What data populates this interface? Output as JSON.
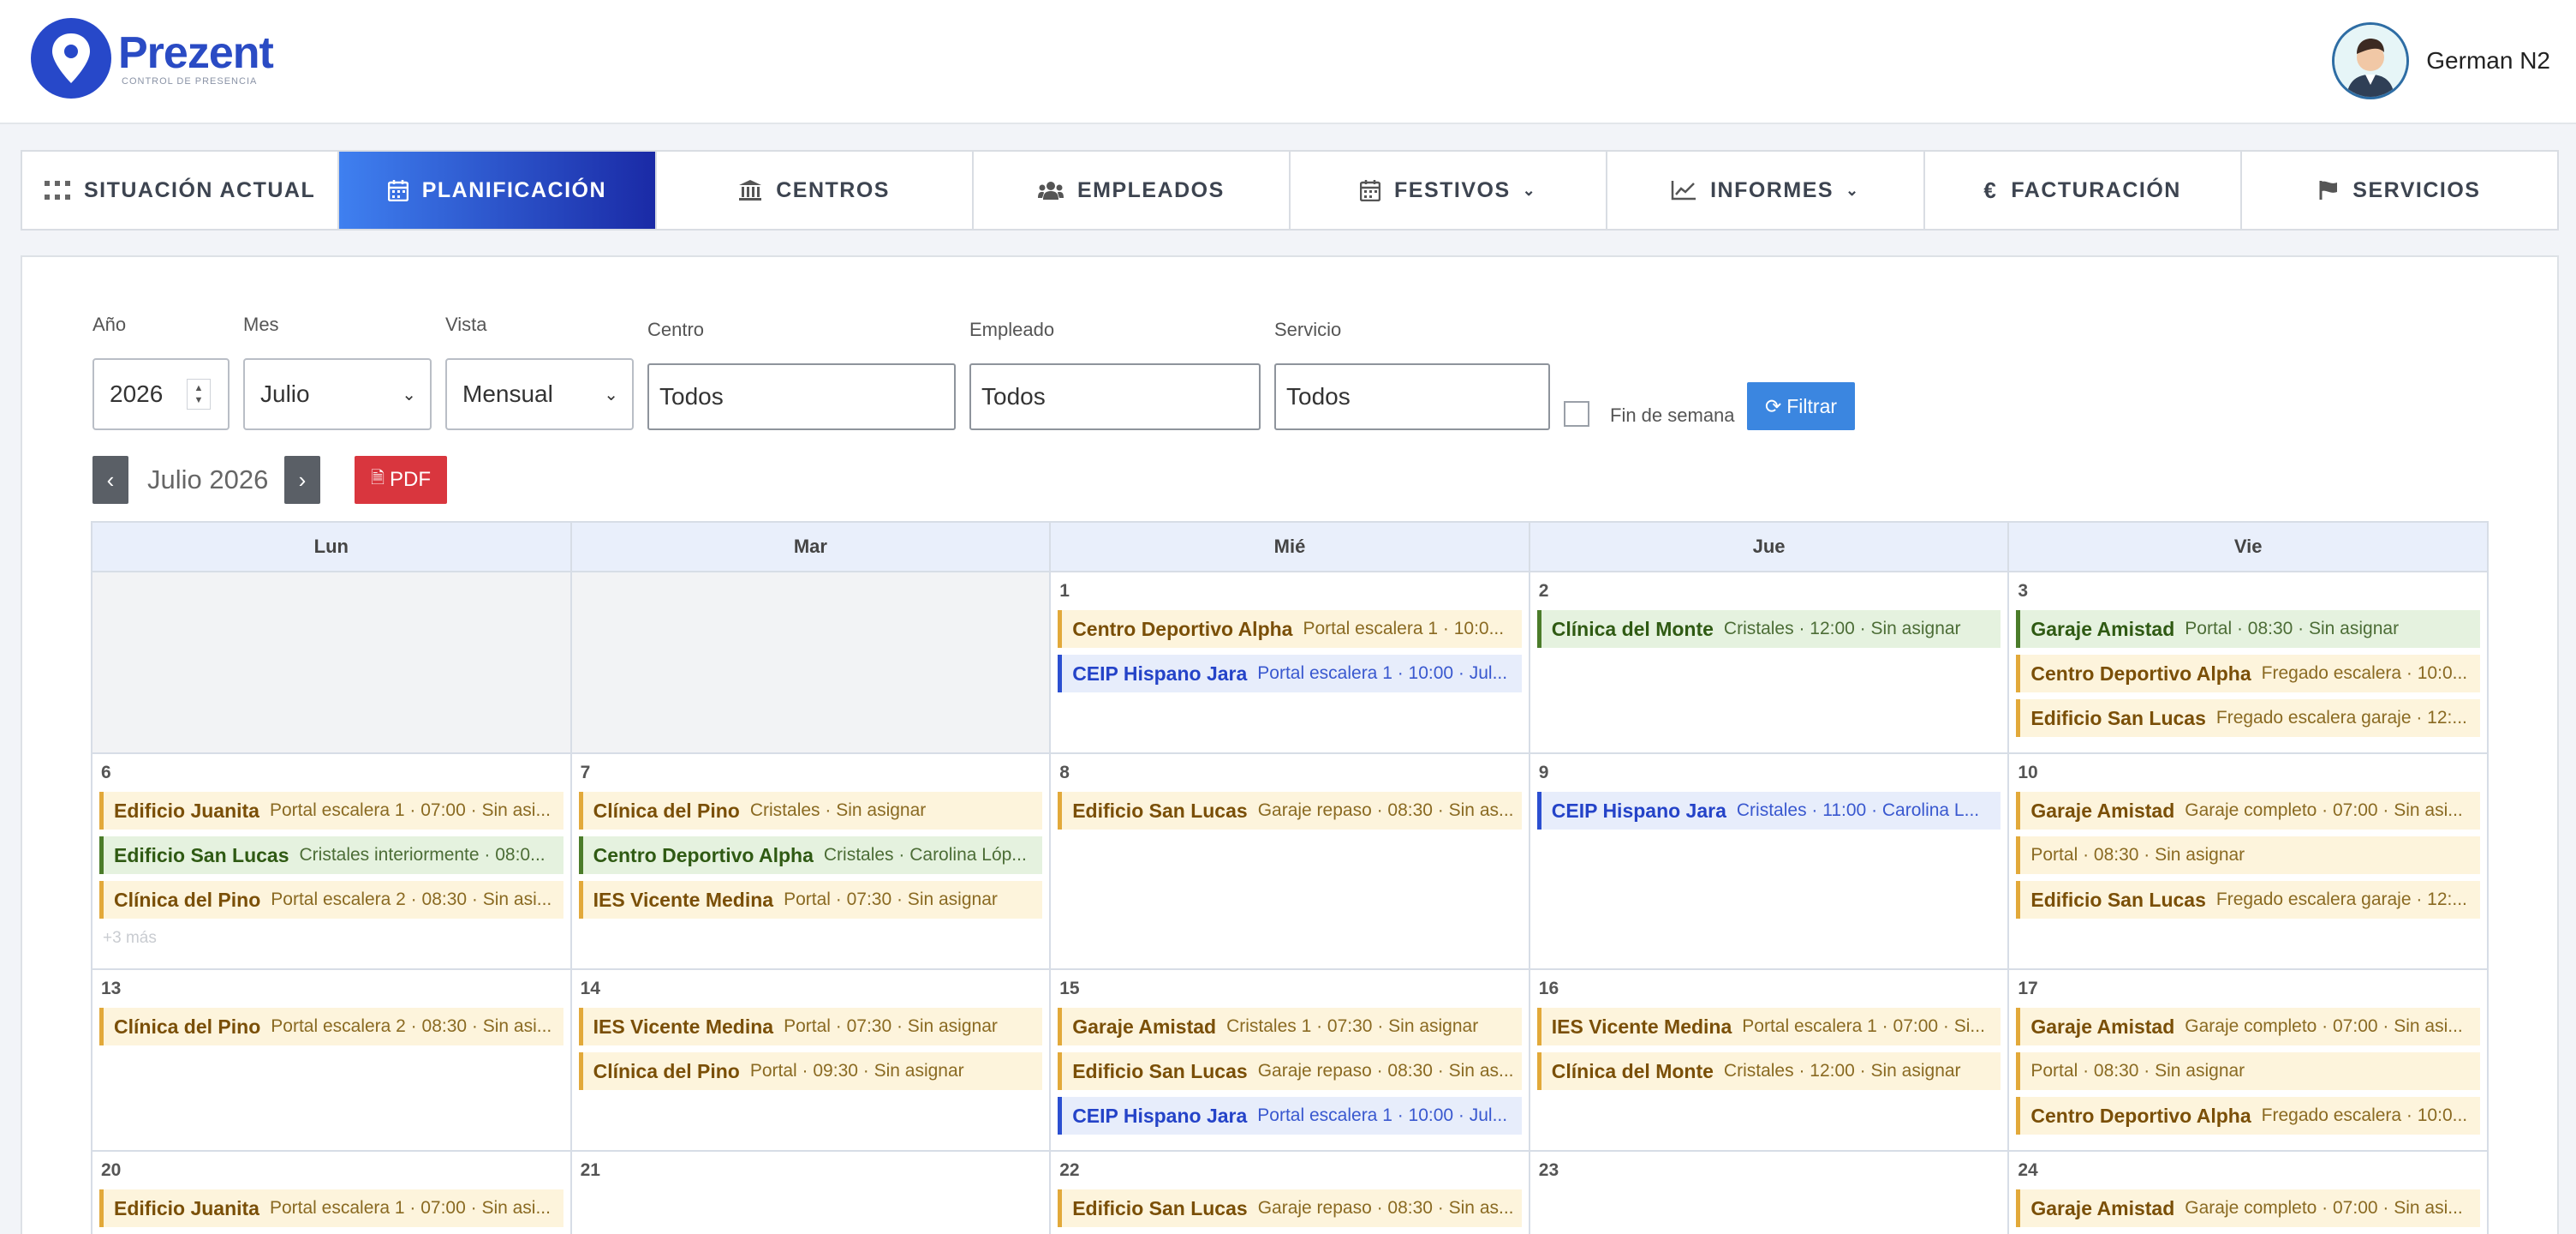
{
  "header": {
    "logo_name": "Prezent",
    "logo_sub": "CONTROL DE PRESENCIA",
    "user_name": "German N2"
  },
  "nav": {
    "items": [
      {
        "label": "SITUACIÓN ACTUAL",
        "icon": "grid-icon"
      },
      {
        "label": "PLANIFICACIÓN",
        "icon": "calendar-icon",
        "active": true
      },
      {
        "label": "CENTROS",
        "icon": "building-icon"
      },
      {
        "label": "EMPLEADOS",
        "icon": "users-icon"
      },
      {
        "label": "FESTIVOS",
        "icon": "calendar-icon",
        "dropdown": true
      },
      {
        "label": "INFORMES",
        "icon": "chart-icon",
        "dropdown": true
      },
      {
        "label": "FACTURACIÓN",
        "icon": "euro-icon"
      },
      {
        "label": "SERVICIOS",
        "icon": "flag-icon"
      }
    ]
  },
  "filters": {
    "year_label": "Año",
    "year_value": "2026",
    "month_label": "Mes",
    "month_value": "Julio",
    "view_label": "Vista",
    "view_value": "Mensual",
    "center_label": "Centro",
    "center_placeholder": "Todos",
    "employee_label": "Empleado",
    "employee_placeholder": "Todos",
    "service_label": "Servicio",
    "service_placeholder": "Todos",
    "weekend_label": "Fin de semana",
    "filter_button": "Filtrar"
  },
  "calendar": {
    "title": "Julio 2026",
    "prev": "‹",
    "next": "›",
    "pdf_button": "PDF",
    "days": [
      "Lun",
      "Mar",
      "Mié",
      "Jue",
      "Vie"
    ],
    "weeks": [
      [
        {
          "n": "",
          "events": []
        },
        {
          "n": "",
          "events": []
        },
        {
          "n": "1",
          "events": [
            {
              "c": "y",
              "name": "Centro Deportivo Alpha",
              "detail": "Portal escalera 1 · 10:0..."
            },
            {
              "c": "b",
              "name": "CEIP Hispano Jara",
              "detail": "Portal escalera 1 · 10:00 · Jul..."
            }
          ]
        },
        {
          "n": "2",
          "events": [
            {
              "c": "g",
              "name": "Clínica del Monte",
              "detail": "Cristales · 12:00 · Sin asignar"
            }
          ]
        },
        {
          "n": "3",
          "events": [
            {
              "c": "g",
              "name": "Garaje Amistad",
              "detail": "Portal · 08:30 · Sin asignar"
            },
            {
              "c": "y",
              "name": "Centro Deportivo Alpha",
              "detail": "Fregado escalera · 10:0..."
            },
            {
              "c": "y",
              "name": "Edificio San Lucas",
              "detail": "Fregado escalera garaje · 12:..."
            }
          ]
        }
      ],
      [
        {
          "n": "6",
          "more": "+3 más",
          "events": [
            {
              "c": "y",
              "name": "Edificio Juanita",
              "detail": "Portal escalera 1 · 07:00 · Sin asi..."
            },
            {
              "c": "g",
              "name": "Edificio San Lucas",
              "detail": "Cristales interiormente · 08:0..."
            },
            {
              "c": "y",
              "name": "Clínica del Pino",
              "detail": "Portal escalera 2 · 08:30 · Sin asi..."
            }
          ]
        },
        {
          "n": "7",
          "events": [
            {
              "c": "y",
              "name": "Clínica del Pino",
              "detail": "Cristales · Sin asignar"
            },
            {
              "c": "g",
              "name": "Centro Deportivo Alpha",
              "detail": "Cristales · Carolina Lóp..."
            },
            {
              "c": "y",
              "name": "IES Vicente Medina",
              "detail": "Portal · 07:30 · Sin asignar"
            }
          ]
        },
        {
          "n": "8",
          "events": [
            {
              "c": "y",
              "name": "Edificio San Lucas",
              "detail": "Garaje repaso · 08:30 · Sin as..."
            }
          ]
        },
        {
          "n": "9",
          "events": [
            {
              "c": "b",
              "name": "CEIP Hispano Jara",
              "detail": "Cristales · 11:00 · Carolina L..."
            }
          ]
        },
        {
          "n": "10",
          "events": [
            {
              "c": "y",
              "name": "Garaje Amistad",
              "detail": "Garaje completo · 07:00 · Sin asi..."
            },
            {
              "c": "y",
              "name": "",
              "detail": "Portal · 08:30 · Sin asignar"
            },
            {
              "c": "y",
              "name": "Edificio San Lucas",
              "detail": "Fregado escalera garaje · 12:..."
            }
          ]
        }
      ],
      [
        {
          "n": "13",
          "events": [
            {
              "c": "y",
              "name": "Clínica del Pino",
              "detail": "Portal escalera 2 · 08:30 · Sin asi..."
            }
          ]
        },
        {
          "n": "14",
          "events": [
            {
              "c": "y",
              "name": "IES Vicente Medina",
              "detail": "Portal · 07:30 · Sin asignar"
            },
            {
              "c": "y",
              "name": "Clínica del Pino",
              "detail": "Portal · 09:30 · Sin asignar"
            }
          ]
        },
        {
          "n": "15",
          "events": [
            {
              "c": "y",
              "name": "Garaje Amistad",
              "detail": "Cristales 1 · 07:30 · Sin asignar"
            },
            {
              "c": "y",
              "name": "Edificio San Lucas",
              "detail": "Garaje repaso · 08:30 · Sin as..."
            },
            {
              "c": "b",
              "name": "CEIP Hispano Jara",
              "detail": "Portal escalera 1 · 10:00 · Jul..."
            }
          ]
        },
        {
          "n": "16",
          "events": [
            {
              "c": "y",
              "name": "IES Vicente Medina",
              "detail": "Portal escalera 1 · 07:00 · Si..."
            },
            {
              "c": "y",
              "name": "Clínica del Monte",
              "detail": "Cristales · 12:00 · Sin asignar"
            }
          ]
        },
        {
          "n": "17",
          "events": [
            {
              "c": "y",
              "name": "Garaje Amistad",
              "detail": "Garaje completo · 07:00 · Sin asi..."
            },
            {
              "c": "y",
              "name": "",
              "detail": "Portal · 08:30 · Sin asignar"
            },
            {
              "c": "y",
              "name": "Centro Deportivo Alpha",
              "detail": "Fregado escalera · 10:0..."
            }
          ]
        }
      ],
      [
        {
          "n": "20",
          "events": [
            {
              "c": "y",
              "name": "Edificio Juanita",
              "detail": "Portal escalera 1 · 07:00 · Sin asi..."
            }
          ]
        },
        {
          "n": "21",
          "events": []
        },
        {
          "n": "22",
          "events": [
            {
              "c": "y",
              "name": "Edificio San Lucas",
              "detail": "Garaje repaso · 08:30 · Sin as..."
            }
          ]
        },
        {
          "n": "23",
          "events": []
        },
        {
          "n": "24",
          "events": [
            {
              "c": "y",
              "name": "Garaje Amistad",
              "detail": "Garaje completo · 07:00 · Sin asi..."
            }
          ]
        }
      ]
    ]
  }
}
